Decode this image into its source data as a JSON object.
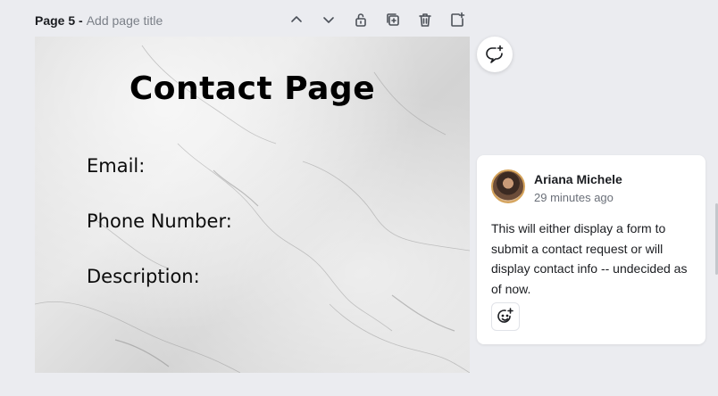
{
  "page": {
    "label": "Page 5 -",
    "title_placeholder": "Add page title"
  },
  "toolbar": {
    "icons": [
      "chevron-up-icon",
      "chevron-down-icon",
      "lock-icon",
      "duplicate-icon",
      "trash-icon",
      "add-page-icon"
    ]
  },
  "canvas": {
    "title": "Contact Page",
    "fields": [
      "Email:",
      "Phone Number:",
      "Description:"
    ]
  },
  "comment": {
    "author": "Ariana Michele",
    "time": "29 minutes ago",
    "text": "This will either display a form to submit a contact request or will display contact info -- undecided as of now."
  }
}
